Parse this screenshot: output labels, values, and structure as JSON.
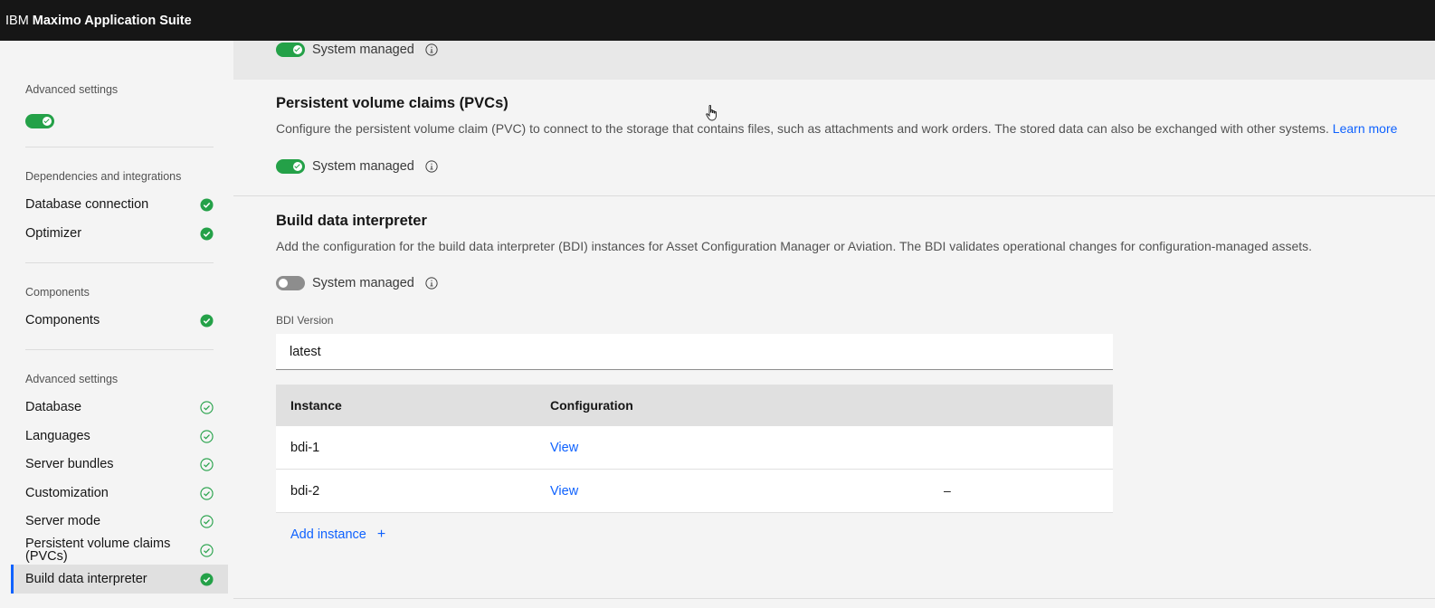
{
  "app": {
    "brand_prefix": "IBM",
    "brand_name": "Maximo Application Suite"
  },
  "sidebar": {
    "top_heading": "Advanced settings",
    "groups": [
      {
        "heading": "Dependencies and integrations",
        "items": [
          {
            "label": "Database connection",
            "status": "complete"
          },
          {
            "label": "Optimizer",
            "status": "complete"
          }
        ]
      },
      {
        "heading": "Components",
        "items": [
          {
            "label": "Components",
            "status": "complete"
          }
        ]
      },
      {
        "heading": "Advanced settings",
        "items": [
          {
            "label": "Database",
            "status": "done-outline"
          },
          {
            "label": "Languages",
            "status": "done-outline"
          },
          {
            "label": "Server bundles",
            "status": "done-outline"
          },
          {
            "label": "Customization",
            "status": "done-outline"
          },
          {
            "label": "Server mode",
            "status": "done-outline"
          },
          {
            "label": "Persistent volume claims (PVCs)",
            "status": "done-outline"
          },
          {
            "label": "Build data interpreter",
            "status": "complete"
          }
        ]
      }
    ],
    "active_item": "Build data interpreter"
  },
  "main": {
    "banner_toggle": {
      "label": "System managed",
      "on": true
    },
    "pvc": {
      "title": "Persistent volume claims (PVCs)",
      "description": "Configure the persistent volume claim (PVC) to connect to the storage that contains files, such as attachments and work orders. The stored data can also be exchanged with other systems.",
      "learn_more": "Learn more",
      "toggle_label": "System managed",
      "toggle_on": true
    },
    "bdi": {
      "title": "Build data interpreter",
      "description": "Add the configuration for the build data interpreter (BDI) instances for Asset Configuration Manager or Aviation. The BDI validates operational changes for configuration-managed assets.",
      "toggle_label": "System managed",
      "toggle_on": false,
      "version_label": "BDI Version",
      "version_value": "latest",
      "table": {
        "headers": [
          "Instance",
          "Configuration"
        ],
        "rows": [
          {
            "instance": "bdi-1",
            "config": "View",
            "action": ""
          },
          {
            "instance": "bdi-2",
            "config": "View",
            "action": "–"
          }
        ]
      },
      "add_instance": "Add instance",
      "add_icon": "+"
    }
  },
  "colors": {
    "accent": "#0f62fe",
    "success": "#24a148",
    "topbar": "#161616"
  }
}
